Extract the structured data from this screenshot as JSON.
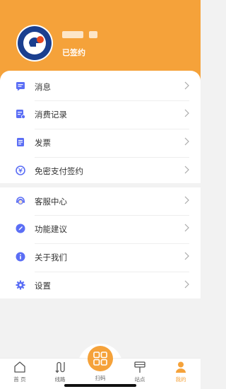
{
  "header": {
    "status": "已签约",
    "accent_color": "#f5a23a"
  },
  "menu": {
    "group1": [
      {
        "label": "消息",
        "icon": "message-icon",
        "color": "#5b6ef5"
      },
      {
        "label": "消费记录",
        "icon": "consumption-record-icon",
        "color": "#5b6ef5"
      },
      {
        "label": "发票",
        "icon": "invoice-icon",
        "color": "#5b6ef5"
      },
      {
        "label": "免密支付签约",
        "icon": "password-free-pay-icon",
        "color": "#5b6ef5"
      }
    ],
    "group2": [
      {
        "label": "客服中心",
        "icon": "customer-service-icon",
        "color": "#5b6ef5"
      },
      {
        "label": "功能建议",
        "icon": "feedback-pencil-icon",
        "color": "#5b6ef5"
      },
      {
        "label": "关于我们",
        "icon": "info-icon",
        "color": "#5b6ef5"
      },
      {
        "label": "设置",
        "icon": "gear-icon",
        "color": "#5b6ef5"
      }
    ]
  },
  "tabbar": {
    "tabs": [
      {
        "label": "首 页",
        "icon": "home-icon"
      },
      {
        "label": "线路",
        "icon": "route-icon"
      },
      {
        "label": "扫码",
        "icon": "scan-qr-icon"
      },
      {
        "label": "站点",
        "icon": "station-icon"
      },
      {
        "label": "我的",
        "icon": "profile-icon",
        "active": true
      }
    ],
    "active_color": "#f5a23a"
  }
}
